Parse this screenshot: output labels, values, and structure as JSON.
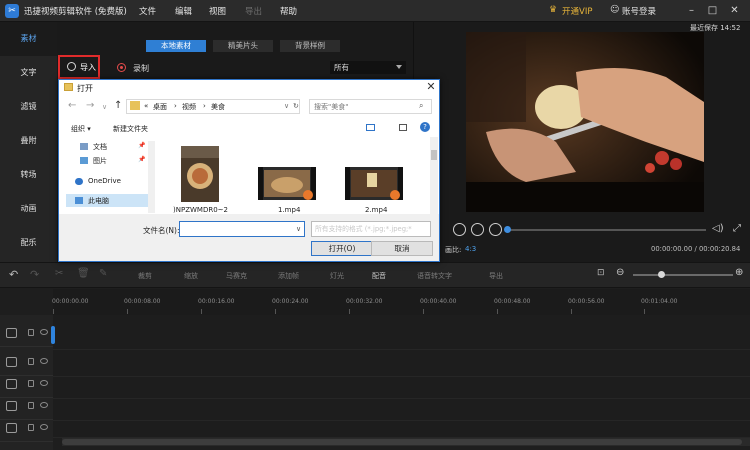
{
  "app": {
    "title": "迅捷视频剪辑软件 (免费版)",
    "menu": [
      "文件",
      "编辑",
      "视图",
      "导出",
      "帮助"
    ],
    "vip": "开通VIP",
    "login": "账号登录",
    "autosave": "最近保存 14:52"
  },
  "sidebar": {
    "items": [
      "素材",
      "文字",
      "滤镜",
      "叠附",
      "转场",
      "动画",
      "配乐"
    ]
  },
  "media": {
    "tabs": [
      "本地素材",
      "精美片头",
      "背景样例"
    ],
    "import_label": "导入",
    "record_label": "录制",
    "filter_value": "所有"
  },
  "preview": {
    "aspect_label": "画比:",
    "aspect_value": "4:3",
    "time": "00:00:00.00 / 00:00:20.84"
  },
  "toolbar": {
    "tools": [
      "裁剪",
      "缩放",
      "马赛克",
      "添加帧",
      "灯光",
      "配音",
      "语音转文字",
      "导出"
    ]
  },
  "timeline": {
    "ticks": [
      "00:00:00.00",
      "00:00:08.00",
      "00:00:16.00",
      "00:00:24.00",
      "00:00:32.00",
      "00:00:40.00",
      "00:00:48.00",
      "00:00:56.00",
      "00:01:04.00"
    ]
  },
  "dialog": {
    "title": "打开",
    "path": [
      "桌面",
      "视频",
      "美食"
    ],
    "search_placeholder": "搜索\"美食\"",
    "organize": "组织 ▾",
    "new_folder": "新建文件夹",
    "tree": [
      "文档",
      "图片",
      "OneDrive",
      "此电脑"
    ],
    "files": [
      ")NPZWMDR0~2",
      "1.mp4",
      "2.mp4"
    ],
    "filename_label": "文件名(N):",
    "filename_value": "",
    "filetype": "所有支持的格式 (*.jpg;*.jpeg;*",
    "open_button": "打开(O)",
    "cancel_button": "取消"
  },
  "colors": {
    "accent": "#2f7fd4",
    "vip": "#e8b53a",
    "import_highlight": "#e02b2b"
  }
}
